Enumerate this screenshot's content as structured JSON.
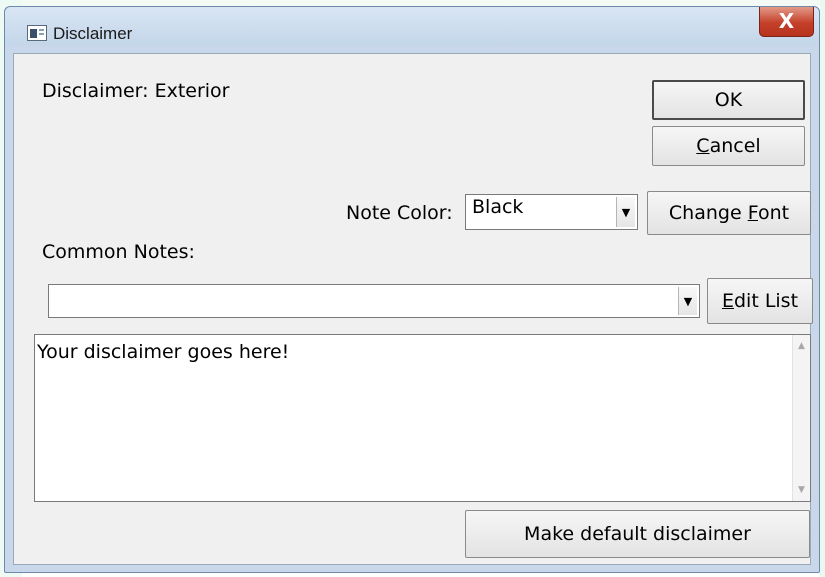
{
  "window": {
    "title": "Disclaimer",
    "close_glyph": "X"
  },
  "dialog": {
    "heading": "Disclaimer: Exterior",
    "ok_label": "OK",
    "cancel_label": "Cancel",
    "note_color_label": "Note Color:",
    "note_color_value": "Black",
    "change_font_label": "Change Font",
    "common_notes_label": "Common Notes:",
    "common_notes_value": "",
    "edit_list_label": "Edit List",
    "disclaimer_text": "Your disclaimer goes here!",
    "make_default_label": "Make default disclaimer"
  },
  "icons": {
    "dropdown_arrow": "▼",
    "scroll_up": "▲",
    "scroll_down": "▼"
  }
}
